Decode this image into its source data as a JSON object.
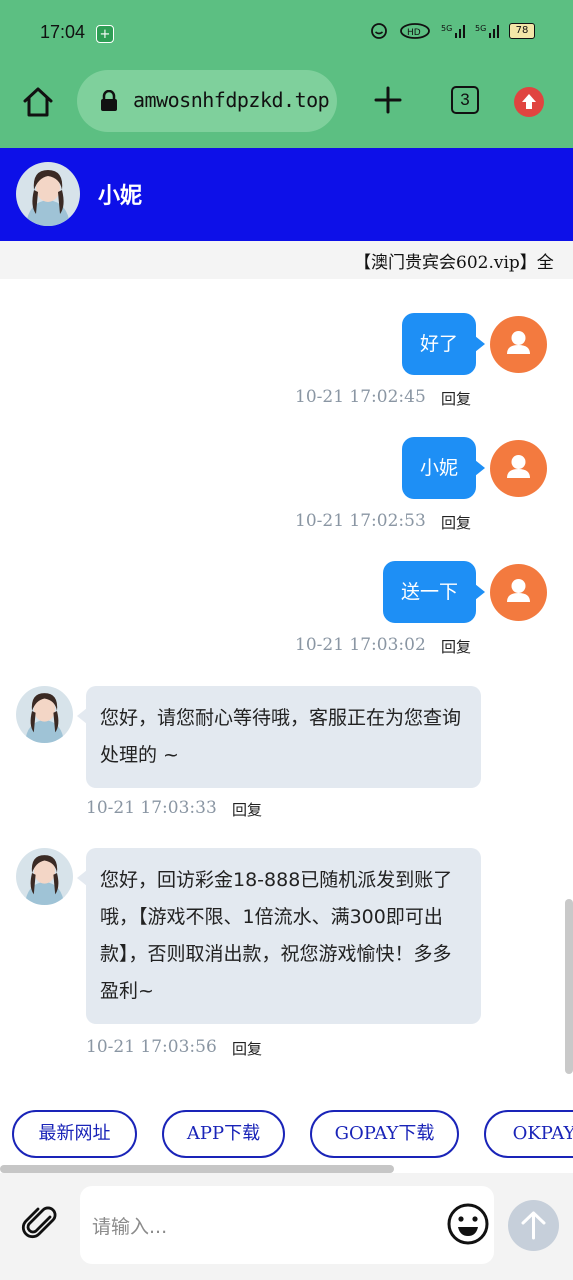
{
  "status_bar": {
    "time": "17:04",
    "shield_icon": "shield-plus-icon",
    "signal_items": [
      "5G",
      "5G"
    ],
    "battery": "78"
  },
  "browser": {
    "url": "amwosnhfdpzkd.top",
    "tab_count": "3"
  },
  "chat_header": {
    "name": "小妮"
  },
  "marquee": {
    "text": "【澳门贵宾会602.vip】全"
  },
  "messages": [
    {
      "from": "me",
      "text": "好了",
      "time": "10-21 17:02:45",
      "reply": "回复"
    },
    {
      "from": "me",
      "text": "小妮",
      "time": "10-21 17:02:53",
      "reply": "回复"
    },
    {
      "from": "me",
      "text": "送一下",
      "time": "10-21 17:03:02",
      "reply": "回复"
    },
    {
      "from": "them",
      "text": "您好，请您耐心等待哦，客服正在为您查询处理的 ~",
      "time": "10-21 17:03:33",
      "reply": "回复"
    },
    {
      "from": "them",
      "text": "您好，回访彩金18-888已随机派发到账了哦，【游戏不限、1倍流水、满300即可出款】，否则取消出款，祝您游戏愉快！多多盈利~",
      "time": "10-21 17:03:56",
      "reply": "回复"
    }
  ],
  "quick_links": [
    "最新网址",
    "APP下载",
    "GOPAY下载",
    "OKPAY"
  ],
  "composer": {
    "placeholder": "请输入..."
  },
  "colors": {
    "browser_bar": "#5cbf82",
    "header": "#0d10e8",
    "my_bubble": "#1e8ff5",
    "their_bubble": "#e3e9f0",
    "user_avatar": "#f37a3f",
    "link_border": "#1a24b8"
  }
}
